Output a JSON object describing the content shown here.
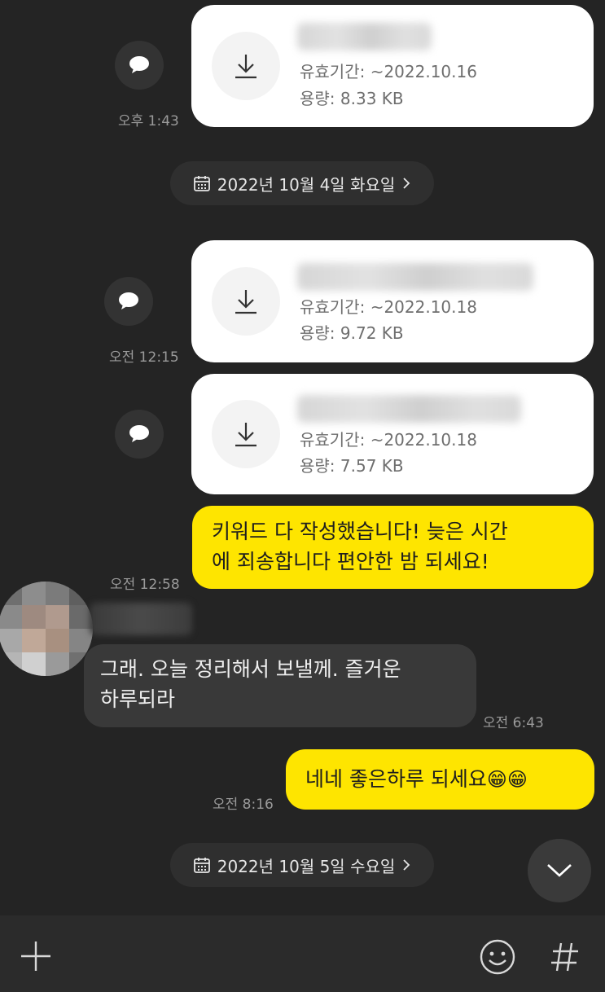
{
  "messages": {
    "file1": {
      "expiry": "유효기간: ~2022.10.16",
      "size": "용량: 8.33 KB",
      "time": "오후 1:43"
    },
    "file2": {
      "expiry": "유효기간: ~2022.10.18",
      "size": "용량: 9.72 KB",
      "time": "오전 12:15"
    },
    "file3": {
      "expiry": "유효기간: ~2022.10.18",
      "size": "용량: 7.57 KB"
    },
    "sent1": {
      "line1": "키워드 다 작성했습니다! 늦은 시간",
      "line2": "에 죄송합니다 편안한 밤 되세요!",
      "time": "오전 12:58"
    },
    "received1": {
      "line1": "그래. 오늘 정리해서 보낼께. 즐거운",
      "line2": "하루되라",
      "time": "오전 6:43"
    },
    "sent2": {
      "text": "네네 좋은하루 되세요",
      "emoji": "😁😁",
      "time": "오전 8:16"
    }
  },
  "date_dividers": {
    "d1": "2022년 10월 4일 화요일",
    "d2": "2022년 10월 5일 수요일"
  },
  "icons": {
    "download": "download-icon",
    "share": "speech-bubble-icon",
    "calendar": "calendar-icon",
    "chevron": "chevron-right-icon",
    "scroll_down": "chevron-down-icon",
    "plus": "plus-icon",
    "emoji": "smiley-icon",
    "hashtag": "hashtag-icon"
  },
  "colors": {
    "background": "#242424",
    "sent_bubble": "#fee500",
    "received_bubble": "#393939",
    "card": "#ffffff"
  }
}
